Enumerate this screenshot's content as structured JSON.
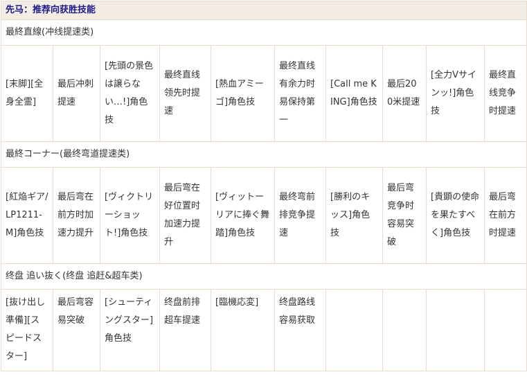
{
  "page": {
    "title": "先马：推荐向获胜技能"
  },
  "sections": [
    {
      "label": "最終直線(冲线提速类)",
      "cells": [
        "[末脚][全身全霊]",
        "最后冲刺提速",
        "[先頭の景色は譲らない…!]角色技",
        "最终直线领先时提速",
        "[熱血アミーゴ]角色技",
        "最终直线有余力时易保持第一",
        "[Call me KING]角色技",
        "最后200米提速",
        "[全力Vサインッ!]角色技",
        "最终直线竞争时提速"
      ]
    },
    {
      "label": "最終コーナー(最终弯道提速类)",
      "cells": [
        "[紅焔ギア/LP1211-M]角色技",
        "最后弯在前方时加速力提升",
        "[ヴィクトリーショット!]角色技",
        "最后弯在好位置时加速力提升",
        "[ヴィットーリアに捧ぐ舞踏]角色技",
        "最终弯前排竞争提速",
        "[勝利のキッス]角色技",
        "最后弯竞争时容易突破",
        "[貴顕の使命を果たすべく]角色技",
        "最后弯在前方时提速"
      ]
    },
    {
      "label": "终盘 追い抜く(终盘 追赶&超车类)",
      "cells": [
        "[抜け出し準備][スピードスター]",
        "最后弯容易突破",
        "[シューティングスター]角色技",
        "终盘前排超车提速",
        "[臨機応変]",
        "终盘路线容易获取",
        "",
        "",
        "",
        ""
      ]
    }
  ]
}
